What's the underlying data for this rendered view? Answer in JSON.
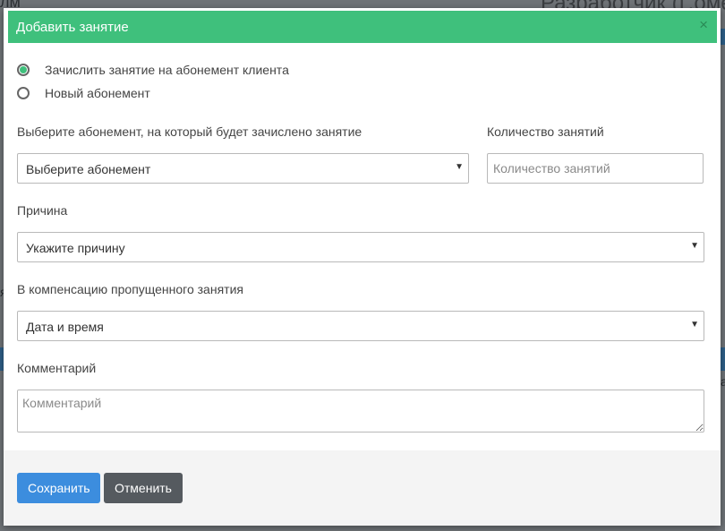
{
  "background": {
    "left_fragment": "лм",
    "right_fragment": "Разработчик (Г.оме",
    "right_fragment2": "а",
    "left_fragment2": "я"
  },
  "modal": {
    "title": "Добавить занятие",
    "close_symbol": "×",
    "radios": [
      {
        "label": "Зачислить занятие на абонемент клиента",
        "checked": true
      },
      {
        "label": "Новый абонемент",
        "checked": false
      }
    ],
    "subscription": {
      "label": "Выберите абонемент, на который будет зачислено занятие",
      "value": "Выберите абонемент"
    },
    "count": {
      "label": "Количество занятий",
      "placeholder": "Количество занятий"
    },
    "reason": {
      "label": "Причина",
      "value": "Укажите причину"
    },
    "compensation": {
      "label": "В компенсацию пропущенного занятия",
      "value": "Дата и время"
    },
    "comment": {
      "label": "Комментарий",
      "placeholder": "Комментарий"
    },
    "footer": {
      "save_label": "Сохранить",
      "cancel_label": "Отменить"
    }
  },
  "colors": {
    "header": "#3fc07c",
    "save_button": "#3c8dde",
    "cancel_button": "#555a5f"
  }
}
